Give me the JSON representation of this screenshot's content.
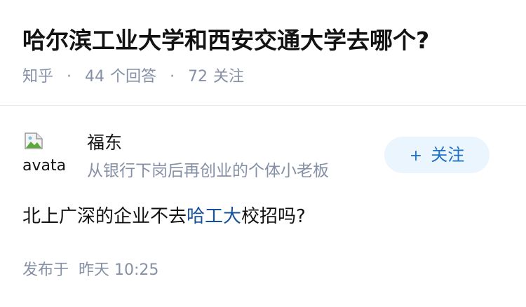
{
  "question": {
    "title": "哈尔滨工业大学和西安交通大学去哪个?",
    "source": "知乎",
    "answer_count": "44",
    "answer_count_label": "个回答",
    "follower_count": "72",
    "follower_count_label": "关注",
    "separator": "·"
  },
  "answer": {
    "author": {
      "avatar_alt": "avatar",
      "name": "福东",
      "bio": "从银行下岗后再创业的个体小老板"
    },
    "follow_button": {
      "icon": "plus-icon",
      "label": "关注"
    },
    "content": {
      "before": "北上广深的企业不去",
      "link": "哈工大",
      "after": "校招吗?"
    },
    "published": {
      "label": "发布于",
      "time": "昨天 10:25"
    }
  },
  "colors": {
    "title": "#121212",
    "meta": "#8590a6",
    "link": "#175199",
    "button_bg": "#ebf5fd",
    "button_text": "#1e70c7",
    "divider": "#ebebeb"
  }
}
